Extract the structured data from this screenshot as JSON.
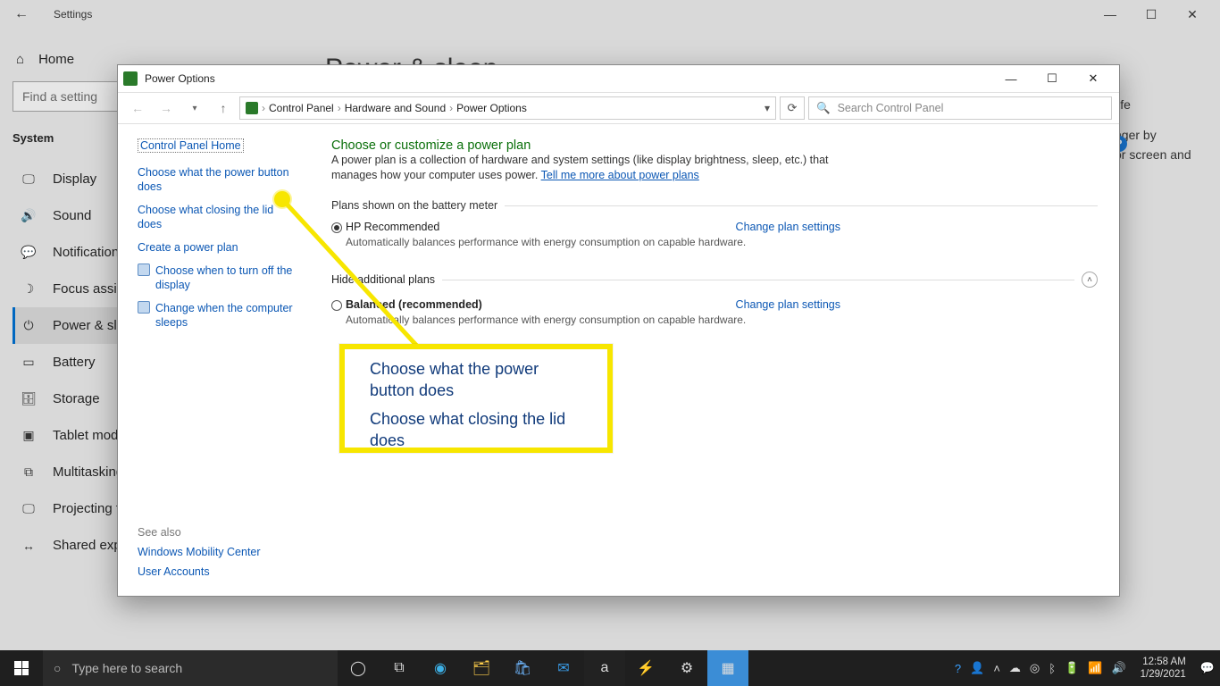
{
  "settings": {
    "title": "Settings",
    "home": "Home",
    "search_placeholder": "Find a setting",
    "section": "System",
    "items": [
      {
        "icon": "🖵",
        "label": "Display"
      },
      {
        "icon": "🔊",
        "label": "Sound"
      },
      {
        "icon": "💬",
        "label": "Notifications & actions"
      },
      {
        "icon": "☽",
        "label": "Focus assist"
      },
      {
        "icon": "⏻",
        "label": "Power & sleep",
        "active": true
      },
      {
        "icon": "▭",
        "label": "Battery"
      },
      {
        "icon": "🗄",
        "label": "Storage"
      },
      {
        "icon": "▣",
        "label": "Tablet mode"
      },
      {
        "icon": "⧉",
        "label": "Multitasking"
      },
      {
        "icon": "🖵",
        "label": "Projecting to this PC"
      },
      {
        "icon": "↔",
        "label": "Shared experiences"
      }
    ],
    "main_heading": "Power & sleep",
    "right_fragment_1": "life",
    "right_fragment_2": "nger by",
    "right_fragment_3": "or screen and"
  },
  "cp": {
    "window_title": "Power Options",
    "breadcrumb": [
      "Control Panel",
      "Hardware and Sound",
      "Power Options"
    ],
    "search_placeholder": "Search Control Panel",
    "side": {
      "home": "Control Panel Home",
      "links": [
        {
          "text": "Choose what the power button does"
        },
        {
          "text": "Choose what closing the lid does"
        },
        {
          "text": "Create a power plan"
        },
        {
          "text": "Choose when to turn off the display",
          "icon": true
        },
        {
          "text": "Change when the computer sleeps",
          "icon": true
        }
      ],
      "seealso_hdr": "See also",
      "seealso": [
        "Windows Mobility Center",
        "User Accounts"
      ]
    },
    "main": {
      "heading": "Choose or customize a power plan",
      "desc_a": "A power plan is a collection of hardware and system settings (like display brightness, sleep, etc.) that manages how your computer uses power. ",
      "desc_link": "Tell me more about power plans",
      "plans_label": "Plans shown on the battery meter",
      "plan1": {
        "name": "HP Recommended",
        "desc": "Automatically balances performance with energy consumption on capable hardware.",
        "change": "Change plan settings"
      },
      "hide_label": "Hide additional plans",
      "plan2": {
        "name": "Balanced (recommended)",
        "desc": "Automatically balances performance with energy consumption on capable hardware.",
        "change": "Change plan settings"
      }
    }
  },
  "callout": {
    "line1": "Choose what the power button does",
    "line2": "Choose what closing the lid does"
  },
  "taskbar": {
    "search": "Type here to search",
    "time": "12:58 AM",
    "date": "1/29/2021"
  }
}
